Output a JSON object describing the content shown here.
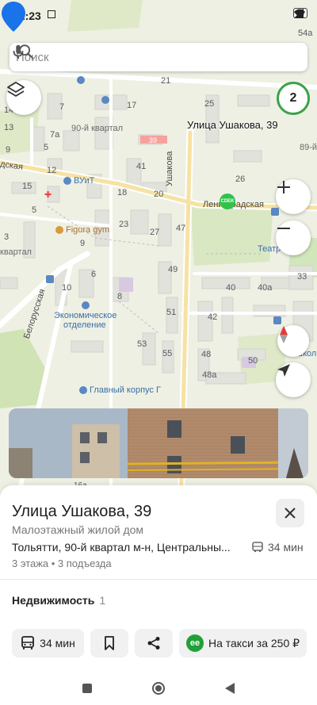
{
  "status_bar": {
    "time": "12:23",
    "battery": "56"
  },
  "search": {
    "placeholder": "Поиск"
  },
  "map": {
    "counter": "2",
    "pin_label": "Улица Ушакова, 39",
    "district": "90-й квартал",
    "district2": "89-й",
    "quarter_left": "квартал",
    "quarter_left2": "дская",
    "streets": {
      "ushakova": "Ушакова",
      "leningradskaya": "Ленинградская",
      "belorusskaya": "Белорусская"
    },
    "pois": {
      "vuit": "ВУиТ",
      "figura": "Figura gym",
      "econ": "Экономическое",
      "econ2": "отделение",
      "korpus": "Главный корпус Г",
      "teatr": "Театр",
      "shkola": "Школ",
      "sdek": "CDEK"
    },
    "building_numbers": [
      "21",
      "25",
      "17",
      "14",
      "39",
      "7",
      "12",
      "41",
      "26",
      "15",
      "18",
      "20",
      "23",
      "47",
      "27",
      "9",
      "49",
      "3",
      "10",
      "40",
      "40a",
      "33",
      "8",
      "51",
      "53",
      "55",
      "42",
      "48",
      "50",
      "48a",
      "16a",
      "5",
      "3",
      "1",
      "9",
      "12",
      "54a",
      "5",
      "7a",
      "13",
      "3"
    ]
  },
  "place": {
    "title": "Улица Ушакова, 39",
    "subtitle": "Малоэтажный жилой дом",
    "address": "Тольятти, 90-й квартал м-н, Центральны...",
    "transit_time": "34 мин",
    "floors": "3 этажа • 3 подъезда",
    "realty_label": "Недвижимость",
    "realty_count": "1"
  },
  "actions": {
    "route": "34 мин",
    "taxi": "На такси за 250 ₽"
  },
  "colors": {
    "accent_blue": "#1a73e8",
    "green": "#3aa24a",
    "taxi_green": "#21a038"
  }
}
